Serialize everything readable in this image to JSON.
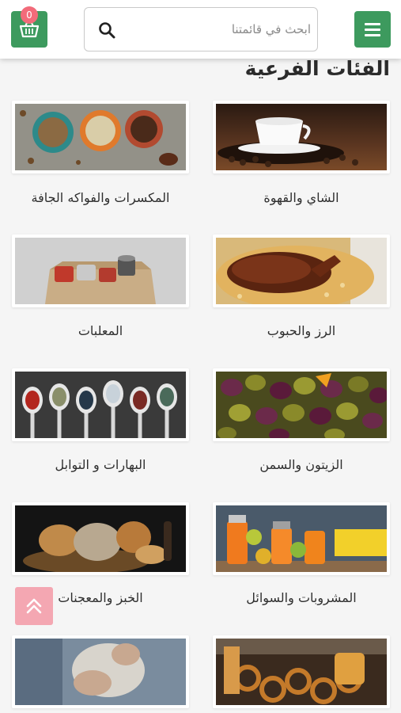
{
  "header": {
    "search_placeholder": "ابحث في قائمتنا",
    "cart_count": "0"
  },
  "section_title": "الفئات الفرعية",
  "categories": [
    {
      "label": "الشاي والقهوة"
    },
    {
      "label": "المكسرات والفواكه الجافة"
    },
    {
      "label": "الرز والحبوب"
    },
    {
      "label": "المعلبات"
    },
    {
      "label": "الزيتون والسمن"
    },
    {
      "label": "البهارات و التوابل"
    },
    {
      "label": "المشروبات والسوائل"
    },
    {
      "label": "الخبز والمعجنات"
    }
  ],
  "colors": {
    "brand_green": "#3d9a5e",
    "badge_pink": "#f26b7a",
    "scroll_pink": "#f4a7b2"
  },
  "icons": [
    "menu-icon",
    "search-icon",
    "cart-icon",
    "chevron-double-up-icon"
  ]
}
